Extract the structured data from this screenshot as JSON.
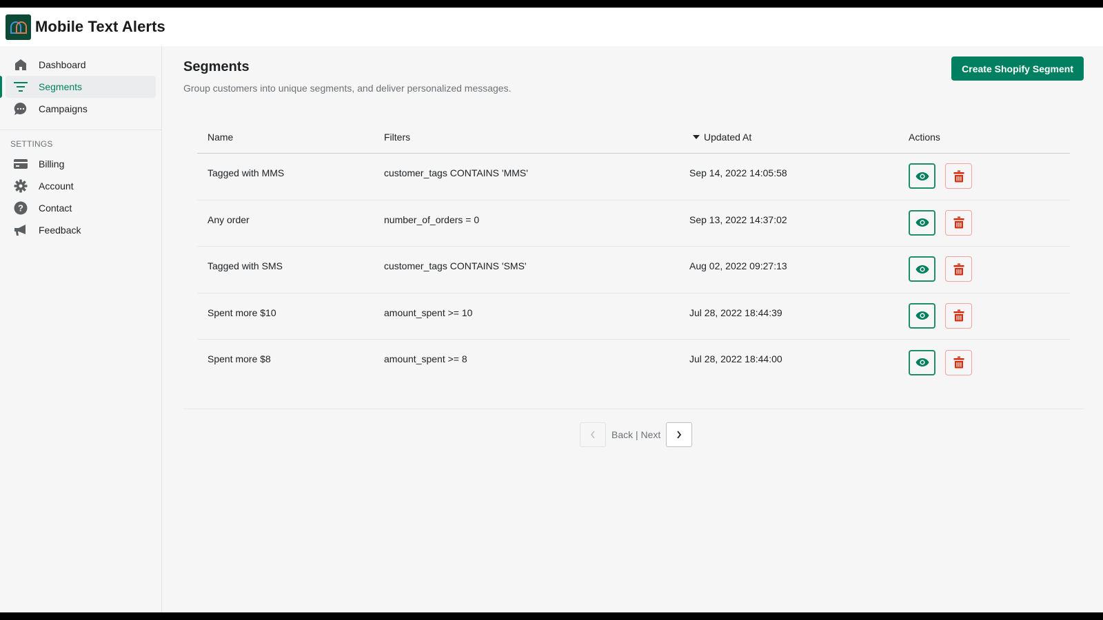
{
  "app": {
    "title": "Mobile Text Alerts",
    "logo_icon": "interlocking-arches-logo"
  },
  "sidebar": {
    "main_items": [
      {
        "label": "Dashboard",
        "icon": "home-icon",
        "active": false
      },
      {
        "label": "Segments",
        "icon": "filter-icon",
        "active": true
      },
      {
        "label": "Campaigns",
        "icon": "chat-bubble-icon",
        "active": false
      }
    ],
    "settings_heading": "SETTINGS",
    "settings_items": [
      {
        "label": "Billing",
        "icon": "credit-card-icon"
      },
      {
        "label": "Account",
        "icon": "gear-icon"
      },
      {
        "label": "Contact",
        "icon": "question-circle-icon"
      },
      {
        "label": "Feedback",
        "icon": "megaphone-icon"
      }
    ]
  },
  "page": {
    "title": "Segments",
    "subtitle": "Group customers into unique segments, and deliver personalized messages.",
    "create_button": "Create Shopify Segment"
  },
  "table": {
    "columns": [
      "Name",
      "Filters",
      "Updated At",
      "Actions"
    ],
    "sorted_column": "Updated At",
    "sort_direction": "descending",
    "rows": [
      {
        "name": "Tagged with MMS",
        "filters": "customer_tags CONTAINS 'MMS'",
        "updated_at": "Sep 14, 2022 14:05:58"
      },
      {
        "name": "Any order",
        "filters": "number_of_orders = 0",
        "updated_at": "Sep 13, 2022 14:37:02"
      },
      {
        "name": "Tagged with SMS",
        "filters": "customer_tags CONTAINS 'SMS'",
        "updated_at": "Aug 02, 2022 09:27:13"
      },
      {
        "name": "Spent more $10",
        "filters": "amount_spent >= 10",
        "updated_at": "Jul 28, 2022 18:44:39"
      },
      {
        "name": "Spent more $8",
        "filters": "amount_spent >= 8",
        "updated_at": "Jul 28, 2022 18:44:00"
      }
    ],
    "actions": {
      "view_icon": "eye-icon",
      "delete_icon": "trash-icon"
    }
  },
  "pagination": {
    "label": "Back | Next",
    "back_enabled": false,
    "next_enabled": true
  },
  "colors": {
    "brand_green": "#008060",
    "danger_red": "#d72c0d",
    "logo_bg": "#0c4a35"
  }
}
